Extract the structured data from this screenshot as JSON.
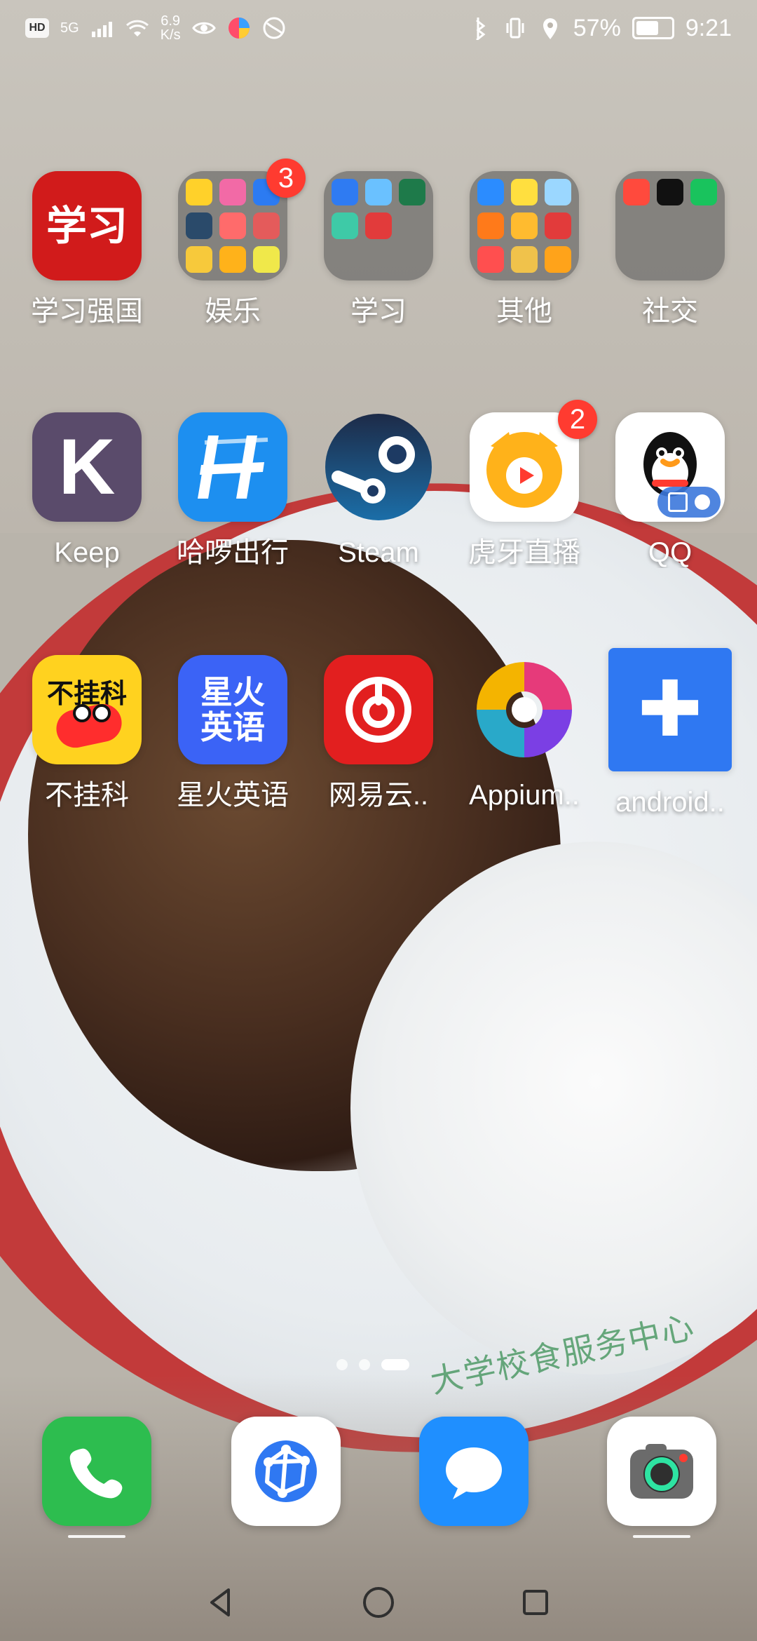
{
  "status_bar": {
    "network_rate_value": "6.9",
    "network_rate_unit": "K/s",
    "signal_label": "5G",
    "hd_label": "HD",
    "battery": "57%",
    "time": "9:21"
  },
  "home": {
    "apps_row1": [
      {
        "label": "学习强国",
        "icon": "xuexi-qiangguo-icon",
        "color": "#d11b1b"
      },
      {
        "label": "娱乐",
        "icon": "folder-icon",
        "badge": "3"
      },
      {
        "label": "学习",
        "icon": "folder-icon"
      },
      {
        "label": "其他",
        "icon": "folder-icon"
      },
      {
        "label": "社交",
        "icon": "folder-icon"
      }
    ],
    "apps_row2": [
      {
        "label": "Keep",
        "icon": "keep-icon",
        "color": "#5a4b6b"
      },
      {
        "label": "哈啰出行",
        "icon": "hello-icon",
        "color": "#1d8ff0"
      },
      {
        "label": "Steam",
        "icon": "steam-icon",
        "color": "#1d4c74"
      },
      {
        "label": "虎牙直播",
        "icon": "huya-icon",
        "badge": "2",
        "color": "#ffffff"
      },
      {
        "label": "QQ",
        "icon": "qq-icon",
        "color": "#ffffff"
      }
    ],
    "apps_row3": [
      {
        "label": "不挂科",
        "icon": "buguake-icon",
        "color": "#ffd21f"
      },
      {
        "label": "星火英语",
        "icon": "xinghuo-icon",
        "color": "#3b63f6"
      },
      {
        "label": "网易云..",
        "icon": "netease-music-icon",
        "color": "#e21f1f"
      },
      {
        "label": "Appium..",
        "icon": "appium-icon",
        "color": "#ffffff"
      },
      {
        "label": "android..",
        "icon": "android-puzzle-icon",
        "color": "#2f78f2"
      }
    ],
    "glyphs": {
      "keep": "K",
      "huya_play": "▶",
      "qq": "QQ",
      "buguake": "不挂科",
      "xinghuo": "星火\n英语",
      "xuexi": "学习",
      "puzzle": "✚"
    },
    "folders": {
      "entertainment_colors": [
        "#ffd12a",
        "#f26aa6",
        "#2c7bf2",
        "#2a4a6a",
        "#ff6b6b",
        "#e45b5b",
        "#f7c93b",
        "#ffb21a",
        "#f0e84a"
      ],
      "study_colors": [
        "#2f7bf2",
        "#6ac1ff",
        "#1e7a4a",
        "#3ecaa7",
        "#e23b3b"
      ],
      "other_colors": [
        "#2b8cff",
        "#ffdf3f",
        "#9bd7ff",
        "#ff7a1a",
        "#ffbb2f",
        "#e23b3b",
        "#ff4f4f",
        "#f0c24b",
        "#ffa31a"
      ],
      "social_colors": [
        "#ff4a3d",
        "#111111",
        "#19c35d"
      ]
    }
  },
  "page_indicator": {
    "pages": 3,
    "active_index": 2
  },
  "dock": [
    {
      "name": "phone",
      "icon": "phone-icon",
      "color": "#2dbd4f"
    },
    {
      "name": "browser",
      "icon": "browser-icon",
      "color": "#ffffff"
    },
    {
      "name": "messages",
      "icon": "message-icon",
      "color": "#1f8fff"
    },
    {
      "name": "camera",
      "icon": "camera-icon",
      "color": "#ffffff"
    }
  ],
  "wallpaper": {
    "plate_text": "大学校食服务中心"
  }
}
